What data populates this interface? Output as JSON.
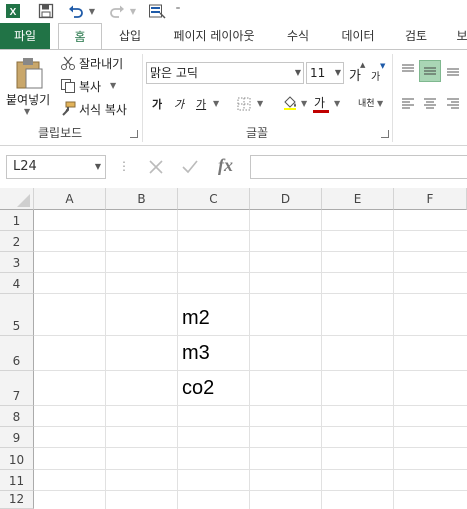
{
  "qat": {
    "icons": [
      "excel-logo-icon",
      "save-icon",
      "undo-icon",
      "redo-icon",
      "form-icon",
      "customize-icon"
    ]
  },
  "tabs": [
    "파일",
    "홈",
    "삽입",
    "페이지 레이아웃",
    "수식",
    "데이터",
    "검토",
    "보"
  ],
  "clipboard": {
    "paste": "붙여넣기",
    "cut": "잘라내기",
    "copy": "복사",
    "format_painter": "서식 복사",
    "group_label": "클립보드"
  },
  "font": {
    "name": "맑은 고딕",
    "size": "11",
    "grow_label": "가",
    "shrink_label": "가",
    "bold_label": "가",
    "italic_label": "가",
    "underline_label": "가",
    "color_label": "가",
    "phonetic_label": "내천",
    "group_label": "글꼴",
    "font_color": "#c00000"
  },
  "formula_bar": {
    "name_box": "L24",
    "fx": "fx",
    "content": ""
  },
  "columns": [
    "A",
    "B",
    "C",
    "D",
    "E",
    "F"
  ],
  "rows": [
    "1",
    "2",
    "3",
    "4",
    "5",
    "6",
    "7",
    "8",
    "9",
    "10",
    "11",
    "12"
  ],
  "cells": {
    "C5": "m2",
    "C6": "m3",
    "C7": "co2"
  },
  "colors": {
    "accent": "#217346",
    "selected_align": "#a9d6b5"
  }
}
